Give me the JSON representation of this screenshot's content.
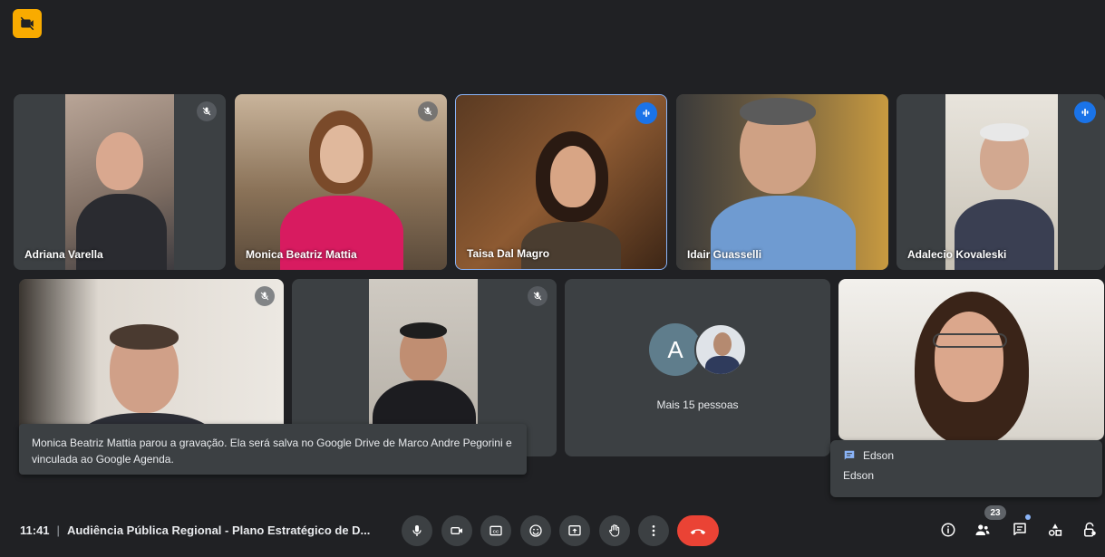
{
  "participants": [
    {
      "name": "Adriana Varella",
      "muted": true,
      "speaking": false
    },
    {
      "name": "Monica Beatriz Mattia",
      "muted": true,
      "speaking": false
    },
    {
      "name": "Taisa Dal Magro",
      "muted": false,
      "speaking": true
    },
    {
      "name": "Idair Guasselli",
      "muted": false,
      "speaking": false
    },
    {
      "name": "Adalecio Kovaleski",
      "muted": false,
      "speaking": true
    },
    {
      "name": "",
      "muted": true,
      "speaking": false
    },
    {
      "name": "",
      "muted": true,
      "speaking": false
    }
  ],
  "others_tile": {
    "avatar_letter": "A",
    "label": "Mais 15 pessoas"
  },
  "toast": {
    "message": "Monica Beatriz Mattia parou a gravação. Ela será salva no Google Drive de Marco Andre Pegorini e vinculada ao Google Agenda."
  },
  "chat_popup": {
    "sender": "Edson",
    "message": "Edson"
  },
  "bottom_bar": {
    "time": "11:41",
    "separator": "|",
    "meeting_title": "Audiência Pública Regional - Plano Estratégico de D...",
    "participant_count": "23"
  },
  "icons": {
    "recording": "recording-icon",
    "mic": "mic-icon",
    "camera": "camera-icon",
    "captions": "captions-icon",
    "emoji": "emoji-icon",
    "present": "present-icon",
    "raise_hand": "raise-hand-icon",
    "more": "more-icon",
    "end_call": "end-call-icon",
    "info": "info-icon",
    "people": "people-icon",
    "chat": "chat-icon",
    "activities": "activities-icon",
    "host_controls": "host-controls-icon"
  },
  "colors": {
    "background": "#202124",
    "tile": "#3c4043",
    "end_call": "#ea4335",
    "speaking": "#1a73e8",
    "recording": "#f9ab00"
  }
}
